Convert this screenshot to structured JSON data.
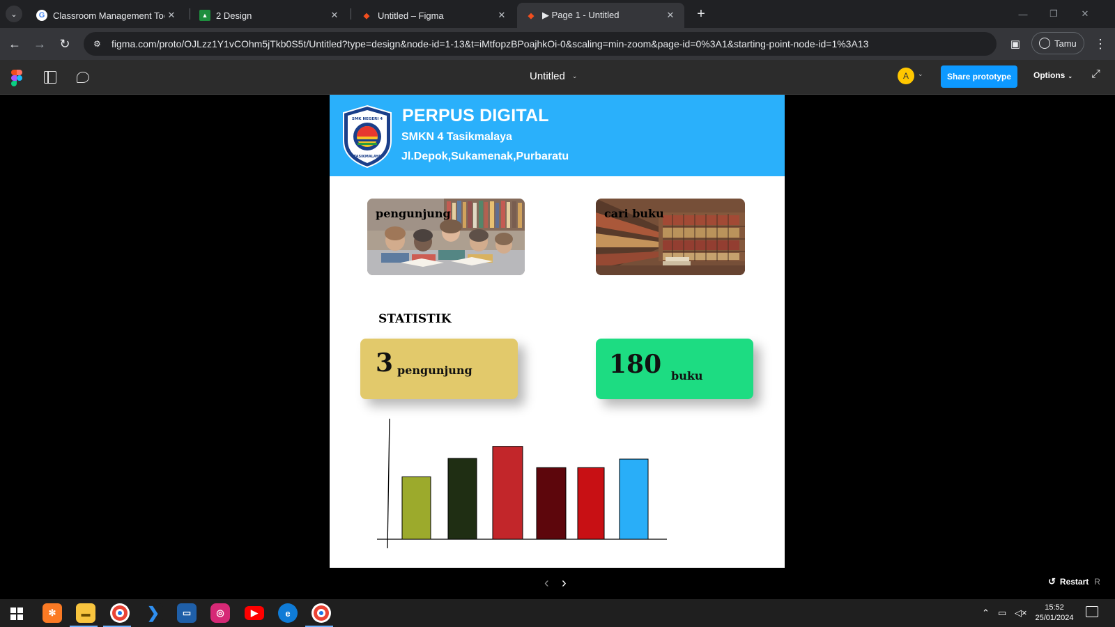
{
  "browser": {
    "tabs": [
      {
        "title": "Classroom Management Tools & R",
        "favicon": "google-icon",
        "active": false
      },
      {
        "title": "2 Design",
        "favicon": "classroom-icon",
        "active": false
      },
      {
        "title": "Untitled – Figma",
        "favicon": "figma-icon",
        "active": false
      },
      {
        "title": "▶ Page 1 - Untitled",
        "favicon": "figma-icon",
        "active": true
      }
    ],
    "new_tab_label": "+",
    "url": "figma.com/proto/OJLzz1Y1vCOhm5jTkb0S5t/Untitled?type=design&node-id=1-13&t=iMtfopzBPoajhkOi-0&scaling=min-zoom&page-id=0%3A1&starting-point-node-id=1%3A13",
    "profile_label": "Tamu"
  },
  "figma": {
    "file_title": "Untitled",
    "avatar_initial": "A",
    "share_label": "Share prototype",
    "options_label": "Options",
    "restart_label": "Restart",
    "restart_key": "R"
  },
  "page": {
    "title": "PERPUS DIGITAL",
    "subtitle": "SMKN 4 Tasikmalaya",
    "address": "Jl.Depok,Sukamenak,Purbaratu",
    "logo_text_top": "SMK NEGERI 4",
    "logo_text_bottom": "TASIKMALAYA",
    "card_visitors_label": "pengunjung",
    "card_books_label": "cari buku",
    "stats_heading": "STATISTIK",
    "stat_visitors_value": "3",
    "stat_visitors_unit": "pengunjung",
    "stat_books_value": "180",
    "stat_books_unit": "buku",
    "colors": {
      "header": "#2ab0fb",
      "visitors_card": "#e2c96b",
      "books_card": "#1ddc82"
    }
  },
  "chart_data": {
    "type": "bar",
    "categories": [
      "",
      "",
      "",
      "",
      "",
      ""
    ],
    "values": [
      88,
      114,
      131,
      101,
      101,
      113
    ],
    "colors": [
      "#9caa2c",
      "#1f2e13",
      "#c2262a",
      "#5d060c",
      "#c81014",
      "#29aef8"
    ],
    "title": "",
    "xlabel": "",
    "ylabel": "",
    "ylim": [
      0,
      170
    ],
    "grid": false
  },
  "taskbar": {
    "apps": [
      "xampp-icon",
      "file-explorer-icon",
      "chrome-icon",
      "vscode-icon",
      "remote-desktop-icon",
      "instagram-icon",
      "youtube-icon",
      "edge-icon",
      "chrome-icon"
    ],
    "time": "15:52",
    "date": "25/01/2024"
  }
}
